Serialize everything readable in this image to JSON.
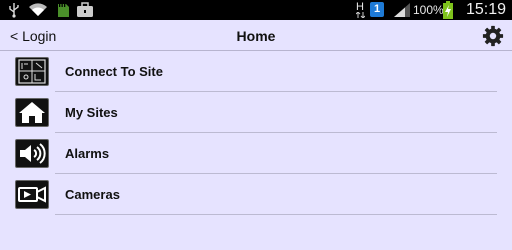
{
  "status_bar": {
    "battery_percent": "100%",
    "time": "15:19",
    "network_type": "H",
    "notification_count": "1",
    "icons": [
      "usb-icon",
      "wifi-icon",
      "sd-card-icon",
      "briefcase-icon",
      "network-h-icon",
      "notification-icon",
      "signal-icon",
      "battery-icon"
    ]
  },
  "header": {
    "back_label": "< Login",
    "title": "Home",
    "settings_icon": "gear-icon"
  },
  "menu": {
    "items": [
      {
        "label": "Connect To Site",
        "icon": "connect-site-icon"
      },
      {
        "label": "My Sites",
        "icon": "home-icon"
      },
      {
        "label": "Alarms",
        "icon": "speaker-icon"
      },
      {
        "label": "Cameras",
        "icon": "camera-icon"
      }
    ]
  },
  "colors": {
    "background": "#e6e3ff",
    "status_bar": "#000000",
    "battery_green": "#7fc31c",
    "notification_blue": "#1e7ad6"
  }
}
